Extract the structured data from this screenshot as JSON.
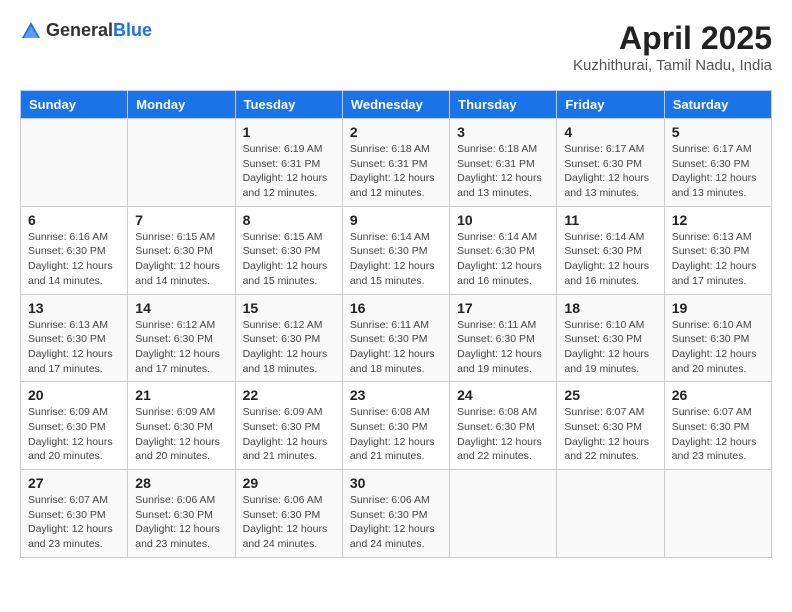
{
  "header": {
    "logo_general": "General",
    "logo_blue": "Blue",
    "title": "April 2025",
    "subtitle": "Kuzhithurai, Tamil Nadu, India"
  },
  "columns": [
    "Sunday",
    "Monday",
    "Tuesday",
    "Wednesday",
    "Thursday",
    "Friday",
    "Saturday"
  ],
  "weeks": [
    [
      {
        "day": "",
        "info": ""
      },
      {
        "day": "",
        "info": ""
      },
      {
        "day": "1",
        "sunrise": "Sunrise: 6:19 AM",
        "sunset": "Sunset: 6:31 PM",
        "daylight": "Daylight: 12 hours and 12 minutes."
      },
      {
        "day": "2",
        "sunrise": "Sunrise: 6:18 AM",
        "sunset": "Sunset: 6:31 PM",
        "daylight": "Daylight: 12 hours and 12 minutes."
      },
      {
        "day": "3",
        "sunrise": "Sunrise: 6:18 AM",
        "sunset": "Sunset: 6:31 PM",
        "daylight": "Daylight: 12 hours and 13 minutes."
      },
      {
        "day": "4",
        "sunrise": "Sunrise: 6:17 AM",
        "sunset": "Sunset: 6:30 PM",
        "daylight": "Daylight: 12 hours and 13 minutes."
      },
      {
        "day": "5",
        "sunrise": "Sunrise: 6:17 AM",
        "sunset": "Sunset: 6:30 PM",
        "daylight": "Daylight: 12 hours and 13 minutes."
      }
    ],
    [
      {
        "day": "6",
        "sunrise": "Sunrise: 6:16 AM",
        "sunset": "Sunset: 6:30 PM",
        "daylight": "Daylight: 12 hours and 14 minutes."
      },
      {
        "day": "7",
        "sunrise": "Sunrise: 6:15 AM",
        "sunset": "Sunset: 6:30 PM",
        "daylight": "Daylight: 12 hours and 14 minutes."
      },
      {
        "day": "8",
        "sunrise": "Sunrise: 6:15 AM",
        "sunset": "Sunset: 6:30 PM",
        "daylight": "Daylight: 12 hours and 15 minutes."
      },
      {
        "day": "9",
        "sunrise": "Sunrise: 6:14 AM",
        "sunset": "Sunset: 6:30 PM",
        "daylight": "Daylight: 12 hours and 15 minutes."
      },
      {
        "day": "10",
        "sunrise": "Sunrise: 6:14 AM",
        "sunset": "Sunset: 6:30 PM",
        "daylight": "Daylight: 12 hours and 16 minutes."
      },
      {
        "day": "11",
        "sunrise": "Sunrise: 6:14 AM",
        "sunset": "Sunset: 6:30 PM",
        "daylight": "Daylight: 12 hours and 16 minutes."
      },
      {
        "day": "12",
        "sunrise": "Sunrise: 6:13 AM",
        "sunset": "Sunset: 6:30 PM",
        "daylight": "Daylight: 12 hours and 17 minutes."
      }
    ],
    [
      {
        "day": "13",
        "sunrise": "Sunrise: 6:13 AM",
        "sunset": "Sunset: 6:30 PM",
        "daylight": "Daylight: 12 hours and 17 minutes."
      },
      {
        "day": "14",
        "sunrise": "Sunrise: 6:12 AM",
        "sunset": "Sunset: 6:30 PM",
        "daylight": "Daylight: 12 hours and 17 minutes."
      },
      {
        "day": "15",
        "sunrise": "Sunrise: 6:12 AM",
        "sunset": "Sunset: 6:30 PM",
        "daylight": "Daylight: 12 hours and 18 minutes."
      },
      {
        "day": "16",
        "sunrise": "Sunrise: 6:11 AM",
        "sunset": "Sunset: 6:30 PM",
        "daylight": "Daylight: 12 hours and 18 minutes."
      },
      {
        "day": "17",
        "sunrise": "Sunrise: 6:11 AM",
        "sunset": "Sunset: 6:30 PM",
        "daylight": "Daylight: 12 hours and 19 minutes."
      },
      {
        "day": "18",
        "sunrise": "Sunrise: 6:10 AM",
        "sunset": "Sunset: 6:30 PM",
        "daylight": "Daylight: 12 hours and 19 minutes."
      },
      {
        "day": "19",
        "sunrise": "Sunrise: 6:10 AM",
        "sunset": "Sunset: 6:30 PM",
        "daylight": "Daylight: 12 hours and 20 minutes."
      }
    ],
    [
      {
        "day": "20",
        "sunrise": "Sunrise: 6:09 AM",
        "sunset": "Sunset: 6:30 PM",
        "daylight": "Daylight: 12 hours and 20 minutes."
      },
      {
        "day": "21",
        "sunrise": "Sunrise: 6:09 AM",
        "sunset": "Sunset: 6:30 PM",
        "daylight": "Daylight: 12 hours and 20 minutes."
      },
      {
        "day": "22",
        "sunrise": "Sunrise: 6:09 AM",
        "sunset": "Sunset: 6:30 PM",
        "daylight": "Daylight: 12 hours and 21 minutes."
      },
      {
        "day": "23",
        "sunrise": "Sunrise: 6:08 AM",
        "sunset": "Sunset: 6:30 PM",
        "daylight": "Daylight: 12 hours and 21 minutes."
      },
      {
        "day": "24",
        "sunrise": "Sunrise: 6:08 AM",
        "sunset": "Sunset: 6:30 PM",
        "daylight": "Daylight: 12 hours and 22 minutes."
      },
      {
        "day": "25",
        "sunrise": "Sunrise: 6:07 AM",
        "sunset": "Sunset: 6:30 PM",
        "daylight": "Daylight: 12 hours and 22 minutes."
      },
      {
        "day": "26",
        "sunrise": "Sunrise: 6:07 AM",
        "sunset": "Sunset: 6:30 PM",
        "daylight": "Daylight: 12 hours and 23 minutes."
      }
    ],
    [
      {
        "day": "27",
        "sunrise": "Sunrise: 6:07 AM",
        "sunset": "Sunset: 6:30 PM",
        "daylight": "Daylight: 12 hours and 23 minutes."
      },
      {
        "day": "28",
        "sunrise": "Sunrise: 6:06 AM",
        "sunset": "Sunset: 6:30 PM",
        "daylight": "Daylight: 12 hours and 23 minutes."
      },
      {
        "day": "29",
        "sunrise": "Sunrise: 6:06 AM",
        "sunset": "Sunset: 6:30 PM",
        "daylight": "Daylight: 12 hours and 24 minutes."
      },
      {
        "day": "30",
        "sunrise": "Sunrise: 6:06 AM",
        "sunset": "Sunset: 6:30 PM",
        "daylight": "Daylight: 12 hours and 24 minutes."
      },
      {
        "day": "",
        "info": ""
      },
      {
        "day": "",
        "info": ""
      },
      {
        "day": "",
        "info": ""
      }
    ]
  ]
}
